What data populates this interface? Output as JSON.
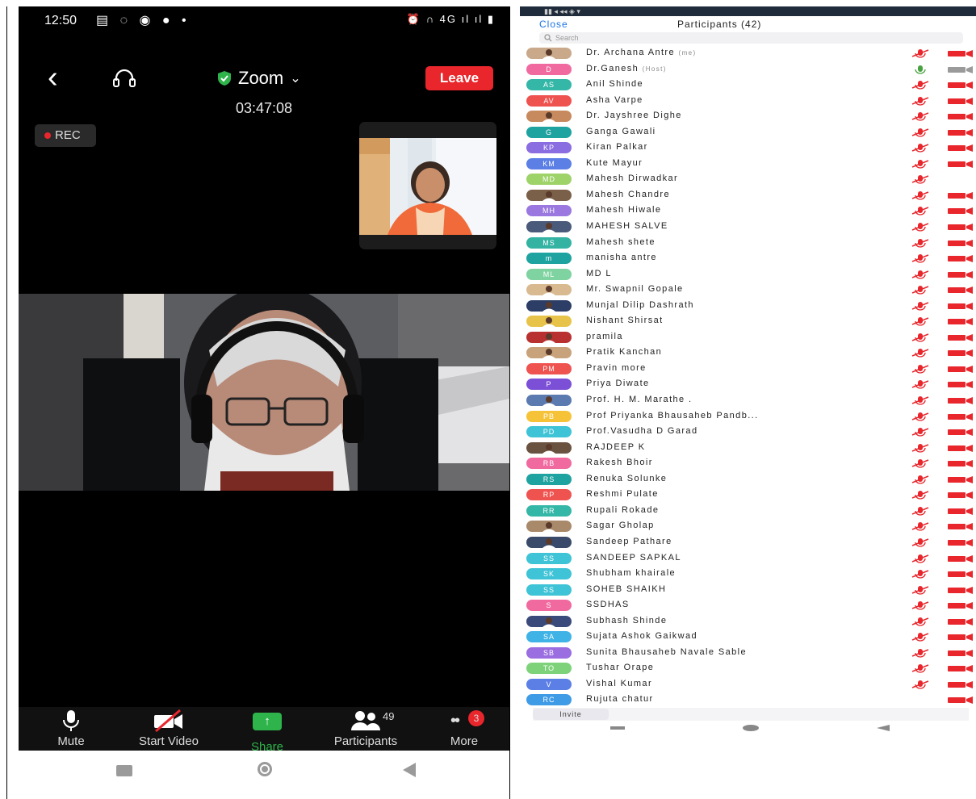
{
  "left": {
    "status": {
      "time": "12:50",
      "notif_icons": [
        "note-icon",
        "whatsapp-icon",
        "compass-icon",
        "facebook-icon",
        "dot-icon"
      ],
      "right_text": "4G"
    },
    "app_title": "Zoom",
    "leave_label": "Leave",
    "timer": "03:47:08",
    "rec_label": "REC",
    "toolbar": {
      "mute": "Mute",
      "start_video": "Start Video",
      "share": "Share",
      "participants": "Participants",
      "participants_count": "49",
      "more": "More",
      "more_badge": "3"
    }
  },
  "right": {
    "close_label": "Close",
    "title": "Participants (42)",
    "search_placeholder": "Search",
    "invite_label": "Invite",
    "colors": {
      "mic_muted": "#e8262c",
      "cam_off": "#e8262c",
      "mic_on": "#48a23f",
      "link": "#1a73e8"
    },
    "participants": [
      {
        "initials": "",
        "name": "Dr. Archana Antre",
        "tag": "(me)",
        "avatar": "photo",
        "color": "#c9a98a",
        "mic": "muted",
        "cam": "off"
      },
      {
        "initials": "D",
        "name": "Dr.Ganesh",
        "tag": "(Host)",
        "avatar": "initials",
        "color": "#f06aa0",
        "mic": "on",
        "cam": "grey"
      },
      {
        "initials": "AS",
        "name": "Anil Shinde",
        "tag": "",
        "avatar": "initials",
        "color": "#35b7a7",
        "mic": "muted",
        "cam": "off"
      },
      {
        "initials": "AV",
        "name": "Asha Varpe",
        "tag": "",
        "avatar": "initials",
        "color": "#ef5350",
        "mic": "muted",
        "cam": "off"
      },
      {
        "initials": "",
        "name": "Dr. Jayshree Dighe",
        "tag": "",
        "avatar": "photo",
        "color": "#c78a5e",
        "mic": "muted",
        "cam": "off"
      },
      {
        "initials": "G",
        "name": "Ganga Gawali",
        "tag": "",
        "avatar": "initials",
        "color": "#1fa3a0",
        "mic": "muted",
        "cam": "off"
      },
      {
        "initials": "KP",
        "name": "Kiran Palkar",
        "tag": "",
        "avatar": "initials",
        "color": "#8a6de0",
        "mic": "muted",
        "cam": "off"
      },
      {
        "initials": "KM",
        "name": "Kute Mayur",
        "tag": "",
        "avatar": "initials",
        "color": "#5c7fe6",
        "mic": "muted",
        "cam": "off"
      },
      {
        "initials": "MD",
        "name": "Mahesh Dirwadkar",
        "tag": "",
        "avatar": "initials",
        "color": "#9ed36a",
        "mic": "muted",
        "cam": "none"
      },
      {
        "initials": "",
        "name": "Mahesh Chandre",
        "tag": "",
        "avatar": "photo",
        "color": "#7a6048",
        "mic": "muted",
        "cam": "off"
      },
      {
        "initials": "MH",
        "name": "Mahesh Hiwale",
        "tag": "",
        "avatar": "initials",
        "color": "#9a78e0",
        "mic": "muted",
        "cam": "off"
      },
      {
        "initials": "",
        "name": "MAHESH SALVE",
        "tag": "",
        "avatar": "photo",
        "color": "#4a5a7a",
        "mic": "muted",
        "cam": "off"
      },
      {
        "initials": "MS",
        "name": "Mahesh shete",
        "tag": "",
        "avatar": "initials",
        "color": "#34b3a3",
        "mic": "muted",
        "cam": "off"
      },
      {
        "initials": "m",
        "name": "manisha antre",
        "tag": "",
        "avatar": "initials",
        "color": "#1fa3a0",
        "mic": "muted",
        "cam": "off"
      },
      {
        "initials": "ML",
        "name": "MD L",
        "tag": "",
        "avatar": "initials",
        "color": "#7ed3a0",
        "mic": "muted",
        "cam": "off"
      },
      {
        "initials": "",
        "name": "Mr. Swapnil Gopale",
        "tag": "",
        "avatar": "photo",
        "color": "#d9b98f",
        "mic": "muted",
        "cam": "off"
      },
      {
        "initials": "",
        "name": "Munjal Dilip Dashrath",
        "tag": "",
        "avatar": "photo",
        "color": "#2c3e66",
        "mic": "muted",
        "cam": "off"
      },
      {
        "initials": "",
        "name": "Nishant Shirsat",
        "tag": "",
        "avatar": "photo",
        "color": "#e7c34a",
        "mic": "muted",
        "cam": "off"
      },
      {
        "initials": "",
        "name": "pramila",
        "tag": "",
        "avatar": "photo",
        "color": "#b83030",
        "mic": "muted",
        "cam": "off"
      },
      {
        "initials": "",
        "name": "Pratik Kanchan",
        "tag": "",
        "avatar": "photo",
        "color": "#c8a27a",
        "mic": "muted",
        "cam": "off"
      },
      {
        "initials": "PM",
        "name": "Pravin more",
        "tag": "",
        "avatar": "initials",
        "color": "#ef5350",
        "mic": "muted",
        "cam": "off"
      },
      {
        "initials": "P",
        "name": "Priya Diwate",
        "tag": "",
        "avatar": "initials",
        "color": "#7b4fd6",
        "mic": "muted",
        "cam": "off"
      },
      {
        "initials": "",
        "name": "Prof. H. M. Marathe .",
        "tag": "",
        "avatar": "photo",
        "color": "#5a7ab0",
        "mic": "muted",
        "cam": "off"
      },
      {
        "initials": "PB",
        "name": "Prof Priyanka Bhausaheb Pandb...",
        "tag": "",
        "avatar": "initials",
        "color": "#f6c338",
        "mic": "muted",
        "cam": "off"
      },
      {
        "initials": "PD",
        "name": "Prof.Vasudha D Garad",
        "tag": "",
        "avatar": "initials",
        "color": "#3fc3d6",
        "mic": "muted",
        "cam": "off"
      },
      {
        "initials": "",
        "name": "RAJDEEP K",
        "tag": "",
        "avatar": "photo",
        "color": "#6a5240",
        "mic": "muted",
        "cam": "off"
      },
      {
        "initials": "RB",
        "name": "Rakesh Bhoir",
        "tag": "",
        "avatar": "initials",
        "color": "#f06aa0",
        "mic": "muted",
        "cam": "off"
      },
      {
        "initials": "RS",
        "name": "Renuka Solunke",
        "tag": "",
        "avatar": "initials",
        "color": "#1fa3a0",
        "mic": "muted",
        "cam": "off"
      },
      {
        "initials": "RP",
        "name": "Reshmi Pulate",
        "tag": "",
        "avatar": "initials",
        "color": "#ef5350",
        "mic": "muted",
        "cam": "off"
      },
      {
        "initials": "RR",
        "name": "Rupali Rokade",
        "tag": "",
        "avatar": "initials",
        "color": "#35b7a7",
        "mic": "muted",
        "cam": "off"
      },
      {
        "initials": "",
        "name": "Sagar Gholap",
        "tag": "",
        "avatar": "photo",
        "color": "#a88a6a",
        "mic": "muted",
        "cam": "off"
      },
      {
        "initials": "",
        "name": "Sandeep Pathare",
        "tag": "",
        "avatar": "photo",
        "color": "#3a4a6a",
        "mic": "muted",
        "cam": "off"
      },
      {
        "initials": "SS",
        "name": "SANDEEP SAPKAL",
        "tag": "",
        "avatar": "initials",
        "color": "#3fc3d6",
        "mic": "muted",
        "cam": "off"
      },
      {
        "initials": "SK",
        "name": "Shubham khairale",
        "tag": "",
        "avatar": "initials",
        "color": "#3fc3d6",
        "mic": "muted",
        "cam": "off"
      },
      {
        "initials": "SS",
        "name": "SOHEB SHAIKH",
        "tag": "",
        "avatar": "initials",
        "color": "#3fc3d6",
        "mic": "muted",
        "cam": "off"
      },
      {
        "initials": "S",
        "name": "SSDHAS",
        "tag": "",
        "avatar": "initials",
        "color": "#f06aa0",
        "mic": "muted",
        "cam": "off"
      },
      {
        "initials": "",
        "name": "Subhash Shinde",
        "tag": "",
        "avatar": "photo",
        "color": "#3a4a7a",
        "mic": "muted",
        "cam": "off"
      },
      {
        "initials": "SA",
        "name": "Sujata Ashok Gaikwad",
        "tag": "",
        "avatar": "initials",
        "color": "#3fb3e6",
        "mic": "muted",
        "cam": "off"
      },
      {
        "initials": "SB",
        "name": "Sunita Bhausaheb Navale Sable",
        "tag": "",
        "avatar": "initials",
        "color": "#9a6de0",
        "mic": "muted",
        "cam": "off"
      },
      {
        "initials": "TO",
        "name": "Tushar Orape",
        "tag": "",
        "avatar": "initials",
        "color": "#7ed37a",
        "mic": "muted",
        "cam": "off"
      },
      {
        "initials": "V",
        "name": "Vishal Kumar",
        "tag": "",
        "avatar": "initials",
        "color": "#5c7fe6",
        "mic": "muted",
        "cam": "off"
      },
      {
        "initials": "RC",
        "name": "Rujuta chatur",
        "tag": "",
        "avatar": "initials",
        "color": "#3f9be6",
        "mic": "none",
        "cam": "off"
      }
    ]
  }
}
